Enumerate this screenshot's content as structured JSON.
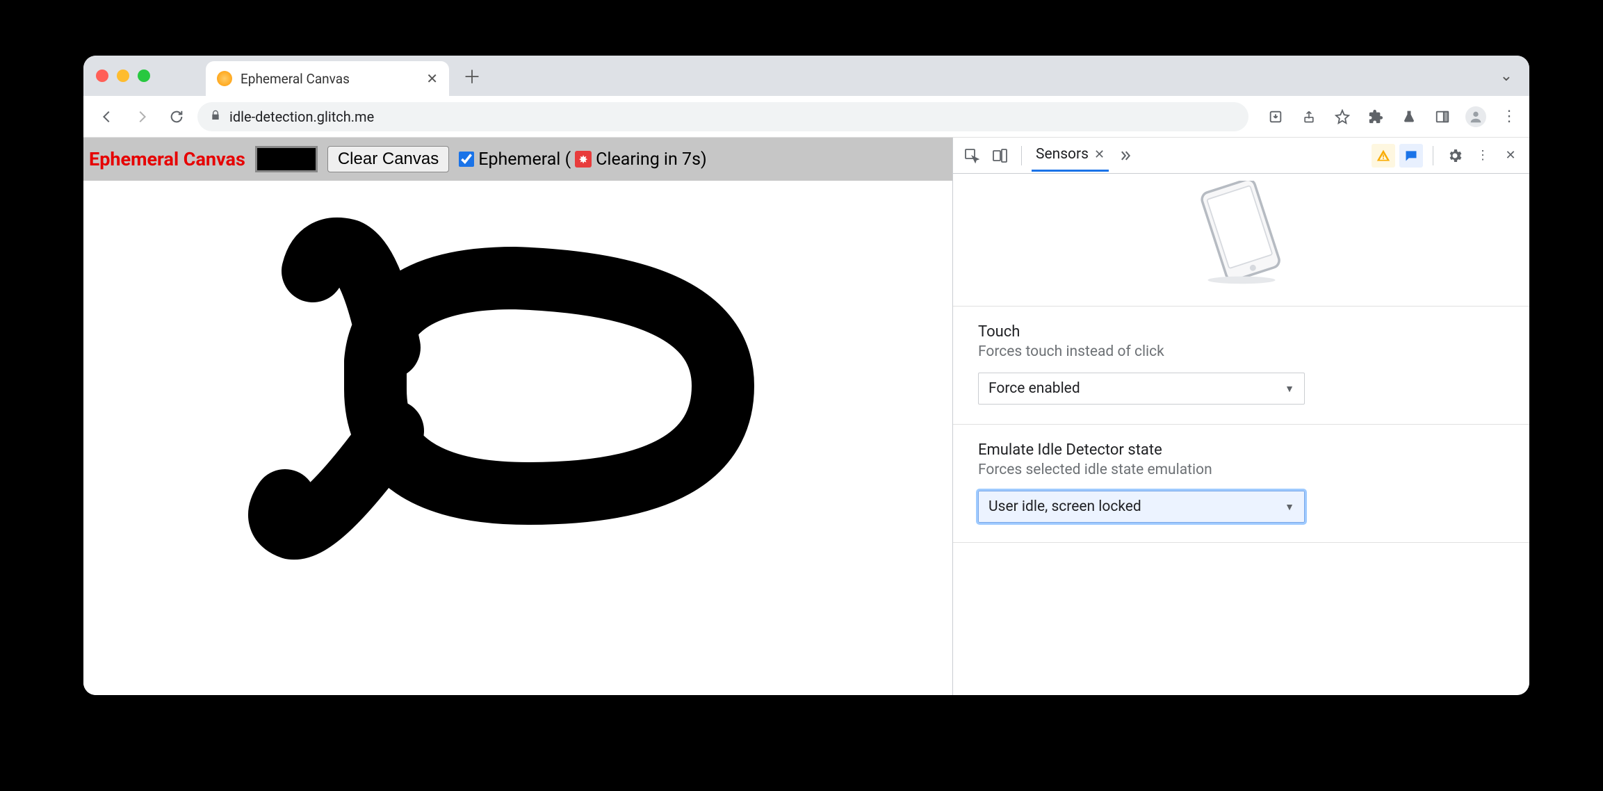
{
  "browser": {
    "tab_title": "Ephemeral Canvas",
    "url": "idle-detection.glitch.me"
  },
  "page": {
    "title": "Ephemeral Canvas",
    "clear_button": "Clear Canvas",
    "ephemeral_label_prefix": "Ephemeral (",
    "ephemeral_label_suffix": " Clearing in 7s)",
    "ephemeral_checked": true
  },
  "devtools": {
    "active_tab": "Sensors",
    "sections": {
      "touch": {
        "label": "Touch",
        "sub": "Forces touch instead of click",
        "value": "Force enabled"
      },
      "idle": {
        "label": "Emulate Idle Detector state",
        "sub": "Forces selected idle state emulation",
        "value": "User idle, screen locked"
      }
    }
  }
}
